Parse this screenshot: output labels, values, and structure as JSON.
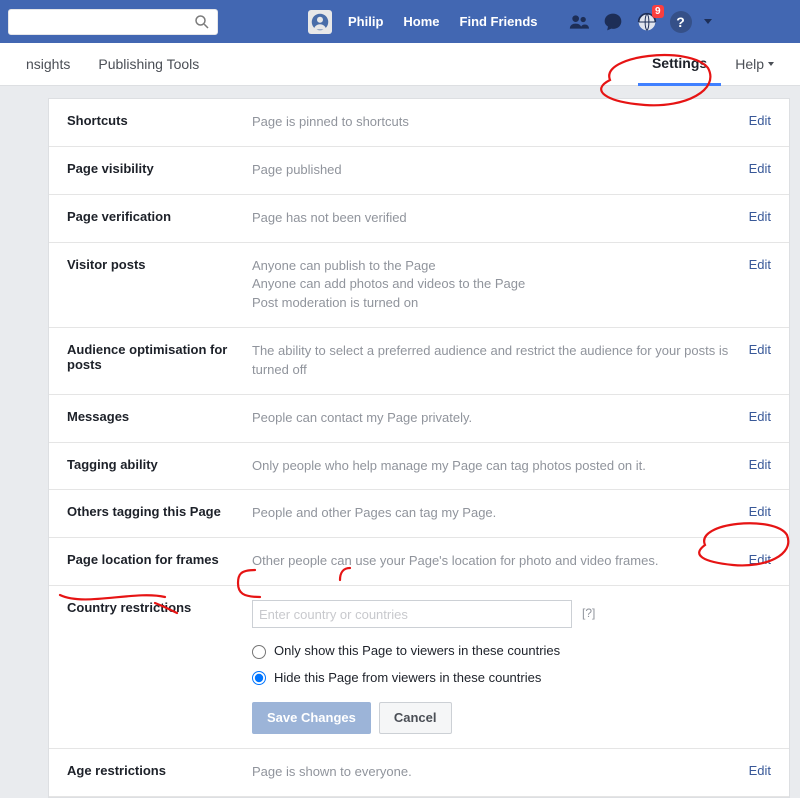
{
  "topbar": {
    "user_name": "Philip",
    "home": "Home",
    "find_friends": "Find Friends",
    "badge_count": "9"
  },
  "tabs": {
    "insights": "nsights",
    "publishing": "Publishing Tools",
    "settings": "Settings",
    "help": "Help"
  },
  "rows": [
    {
      "label": "Shortcuts",
      "body": "Page is pinned to shortcuts",
      "edit": "Edit"
    },
    {
      "label": "Page visibility",
      "body": "Page published",
      "edit": "Edit"
    },
    {
      "label": "Page verification",
      "body": "Page has not been verified",
      "edit": "Edit"
    },
    {
      "label": "Visitor posts",
      "line1": "Anyone can publish to the Page",
      "line2": "Anyone can add photos and videos to the Page",
      "line3": "Post moderation is turned on",
      "edit": "Edit"
    },
    {
      "label": "Audience optimisation for posts",
      "body": "The ability to select a preferred audience and restrict the audience for your posts is turned off",
      "edit": "Edit"
    },
    {
      "label": "Messages",
      "body": "People can contact my Page privately.",
      "edit": "Edit"
    },
    {
      "label": "Tagging ability",
      "body": "Only people who help manage my Page can tag photos posted on it.",
      "edit": "Edit"
    },
    {
      "label": "Others tagging this Page",
      "body": "People and other Pages can tag my Page.",
      "edit": "Edit"
    },
    {
      "label": "Page location for frames",
      "body": "Other people can use your Page's location for photo and video frames.",
      "edit": "Edit"
    }
  ],
  "country": {
    "label": "Country restrictions",
    "placeholder": "Enter country or countries",
    "help_symbol": "[?]",
    "radio_show": "Only show this Page to viewers in these countries",
    "radio_hide": "Hide this Page from viewers in these countries",
    "save": "Save Changes",
    "cancel": "Cancel"
  },
  "age": {
    "label": "Age restrictions",
    "body": "Page is shown to everyone.",
    "edit": "Edit"
  }
}
